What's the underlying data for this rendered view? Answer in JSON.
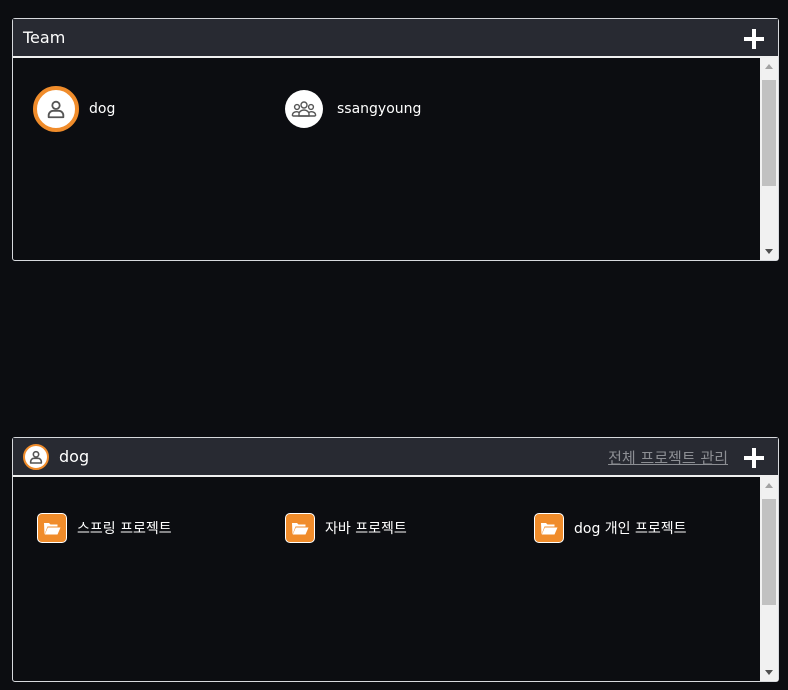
{
  "team_panel": {
    "title": "Team",
    "add_icon": "plus-icon",
    "members": [
      {
        "name": "dog",
        "icon": "user-icon",
        "selected": true
      },
      {
        "name": "ssangyoung",
        "icon": "group-icon",
        "selected": false
      }
    ]
  },
  "project_panel": {
    "owner": "dog",
    "owner_icon": "user-icon",
    "manage_link": "전체 프로젝트 관리",
    "add_icon": "plus-icon",
    "projects": [
      {
        "name": "스프링 프로젝트",
        "icon": "folder-open-icon"
      },
      {
        "name": "자바 프로젝트",
        "icon": "folder-open-icon"
      },
      {
        "name": "dog 개인 프로젝트",
        "icon": "folder-open-icon"
      }
    ]
  },
  "colors": {
    "background": "#0c0d11",
    "header": "#282a32",
    "accent": "#f08c2b",
    "link": "#8c8e93"
  }
}
